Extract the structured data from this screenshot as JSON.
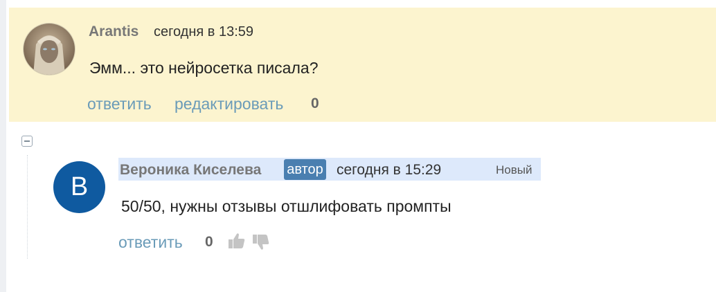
{
  "comments": [
    {
      "author": "Arantis",
      "time": "сегодня в 13:59",
      "text": "Эмм... это нейросетка писала?",
      "actions": {
        "reply": "ответить",
        "edit": "редактировать"
      },
      "score": "0",
      "avatar": "user-photo"
    },
    {
      "author": "Вероника Киселева",
      "badge": "автор",
      "time": "сегодня в 15:29",
      "new_label": "Новый",
      "avatar_letter": "B",
      "text": "50/50, нужны отзывы отшлифовать промпты",
      "actions": {
        "reply": "ответить"
      },
      "score": "0",
      "vote_icons": [
        "thumbs-up-icon",
        "thumbs-down-icon"
      ]
    }
  ],
  "colors": {
    "own_comment_bg": "#fcf4cf",
    "header_highlight": "#dde9fb",
    "link": "#6a9bb8",
    "badge": "#4a7fb0",
    "avatar_bg": "#0f5aa0"
  }
}
